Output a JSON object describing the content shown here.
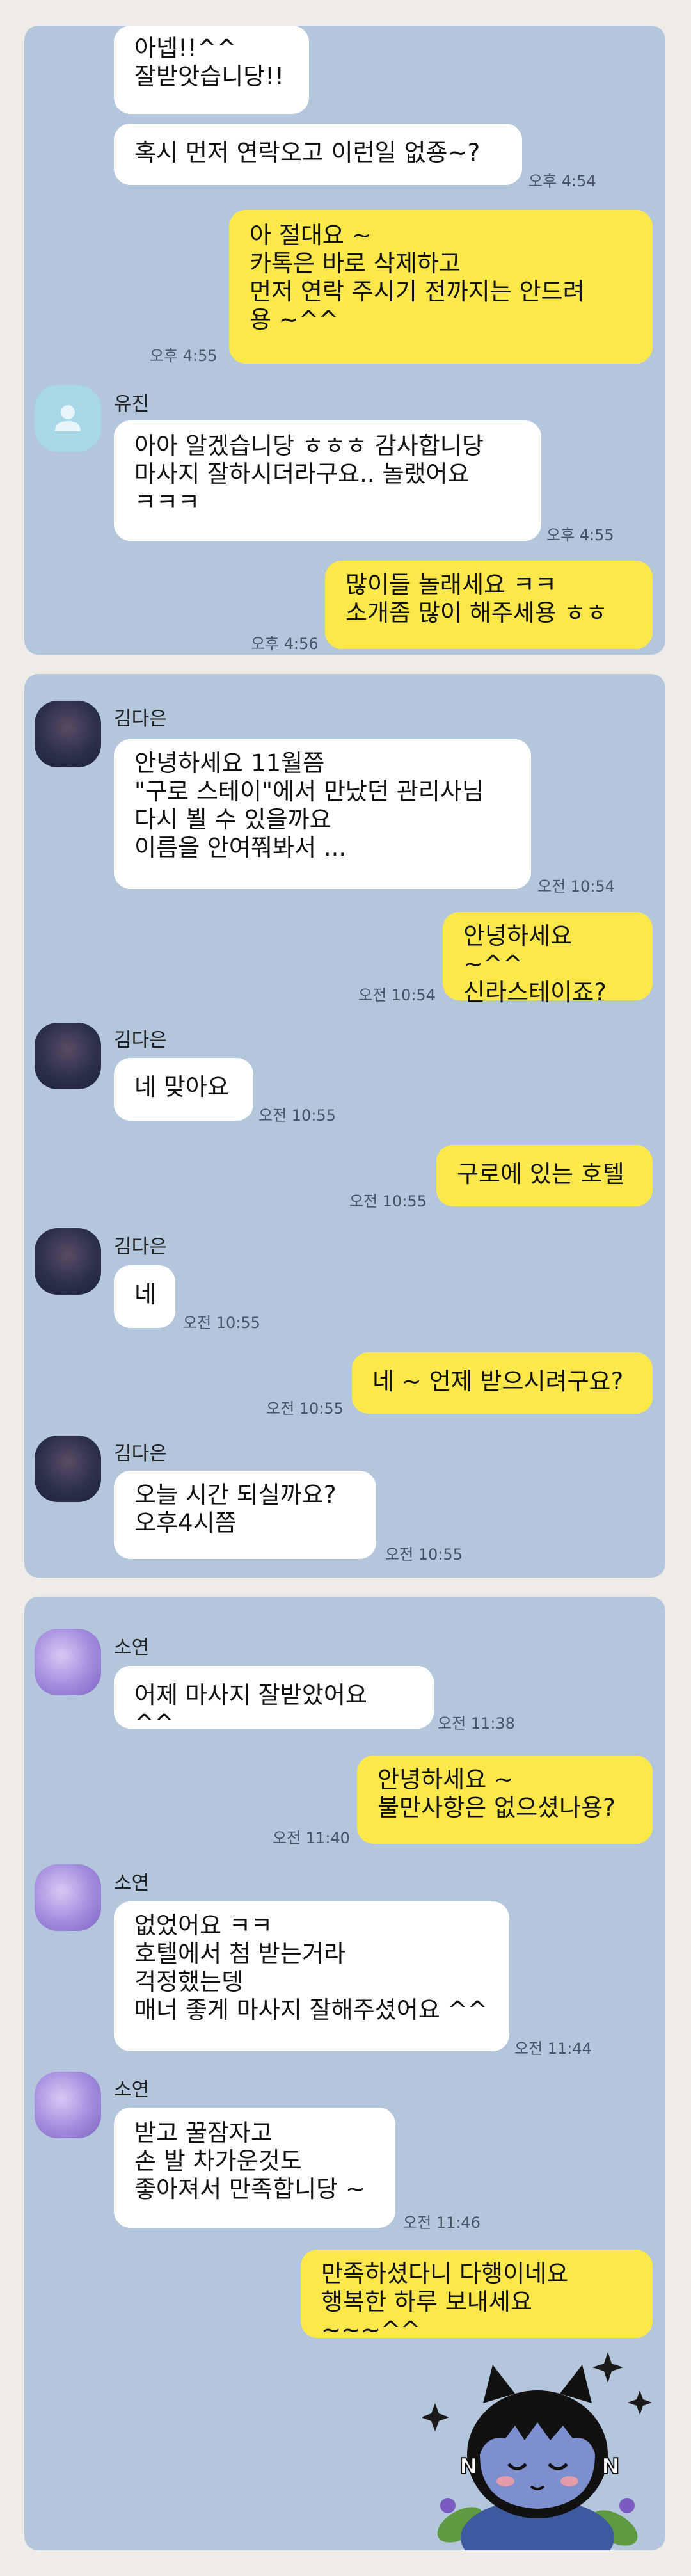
{
  "panel1": {
    "m1": "아넵!!^^\n잘받앗습니당!!",
    "m2": "혹시 먼저 연락오고 이런일 없죵~?",
    "t2": "오후 4:54",
    "m3": "아 절대요 ~\n카톡은 바로 삭제하고\n먼저 연락 주시기 전까지는 안드려\n용 ~^^",
    "t3": "오후 4:55",
    "sender1": "유진",
    "m4": "아아 알겠습니당 ㅎㅎㅎ 감사합니당\n마사지 잘하시더라구요.. 놀랬어요\nㅋㅋㅋ",
    "t4": "오후 4:55",
    "m5": "많이들 놀래세요 ㅋㅋ\n소개좀 많이 해주세용 ㅎㅎ",
    "t5": "오후 4:56"
  },
  "panel2": {
    "sender": "김다은",
    "m1": "안녕하세요 11월쯤\n\"구로 스테이\"에서 만났던 관리사님\n다시 뵐 수 있을까요\n이름을 안여쭤봐서 ...",
    "t1": "오전 10:54",
    "m2": "안녕하세요 ~^^\n신라스테이죠?",
    "t2": "오전 10:54",
    "m3": "네 맞아요",
    "t3": "오전 10:55",
    "m4": "구로에 있는 호텔",
    "t4": "오전 10:55",
    "m5": "네",
    "t5": "오전 10:55",
    "m6": "네 ~ 언제 받으시려구요?",
    "t6": "오전 10:55",
    "m7": "오늘  시간 되실까요?\n오후4시쯤",
    "t7": "오전 10:55"
  },
  "panel3": {
    "sender": "소연",
    "m1": "어제 마사지 잘받았어요 ^^",
    "t1": "오전 11:38",
    "m2": "안녕하세요 ~\n불만사항은 없으셨나용?",
    "t2": "오전 11:40",
    "m3": "없었어요 ㅋㅋ\n호텔에서 첨 받는거라\n걱정했는뎅\n매너 좋게 마사지 잘해주셨어요 ^^",
    "t3": "오전 11:44",
    "m4": "받고 꿀잠자고\n손 발 차가운것도\n좋아져서 만족합니당 ~",
    "t4": "오전 11:46",
    "m5": "만족하셨다니 다행이네요\n행복한 하루 보내세요 ~~~^^"
  },
  "icons": {
    "default_avatar": "person-silhouette-icon",
    "sticker": "kakao-friends-character-sticker"
  }
}
